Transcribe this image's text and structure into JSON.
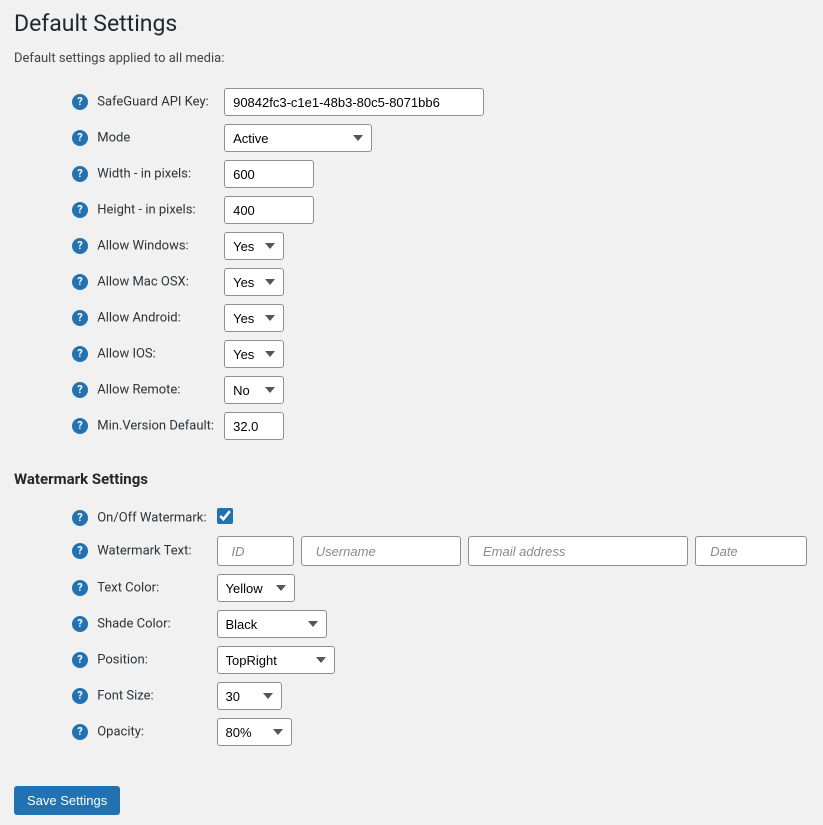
{
  "header": {
    "title": "Default Settings",
    "subtitle": "Default settings applied to all media:"
  },
  "defaults": {
    "api_key": {
      "label": "SafeGuard API Key:",
      "value": "90842fc3-c1e1-48b3-80c5-8071bb6"
    },
    "mode": {
      "label": "Mode",
      "value": "Active"
    },
    "width": {
      "label": "Width - in pixels:",
      "value": "600"
    },
    "height": {
      "label": "Height - in pixels:",
      "value": "400"
    },
    "allow_windows": {
      "label": "Allow Windows:",
      "value": "Yes"
    },
    "allow_mac": {
      "label": "Allow Mac OSX:",
      "value": "Yes"
    },
    "allow_android": {
      "label": "Allow Android:",
      "value": "Yes"
    },
    "allow_ios": {
      "label": "Allow IOS:",
      "value": "Yes"
    },
    "allow_remote": {
      "label": "Allow Remote:",
      "value": "No"
    },
    "min_version": {
      "label": "Min.Version Default:",
      "value": "32.0"
    }
  },
  "watermark": {
    "heading": "Watermark Settings",
    "onoff": {
      "label": "On/Off Watermark:",
      "checked": true
    },
    "text": {
      "label": "Watermark Text:",
      "id_placeholder": "ID",
      "username_placeholder": "Username",
      "email_placeholder": "Email address",
      "date_placeholder": "Date"
    },
    "text_color": {
      "label": "Text Color:",
      "value": "Yellow"
    },
    "shade_color": {
      "label": "Shade Color:",
      "value": "Black"
    },
    "position": {
      "label": "Position:",
      "value": "TopRight"
    },
    "font_size": {
      "label": "Font Size:",
      "value": "30"
    },
    "opacity": {
      "label": "Opacity:",
      "value": "80%"
    }
  },
  "actions": {
    "save": "Save Settings"
  },
  "options": {
    "yesno": [
      "Yes",
      "No"
    ]
  }
}
